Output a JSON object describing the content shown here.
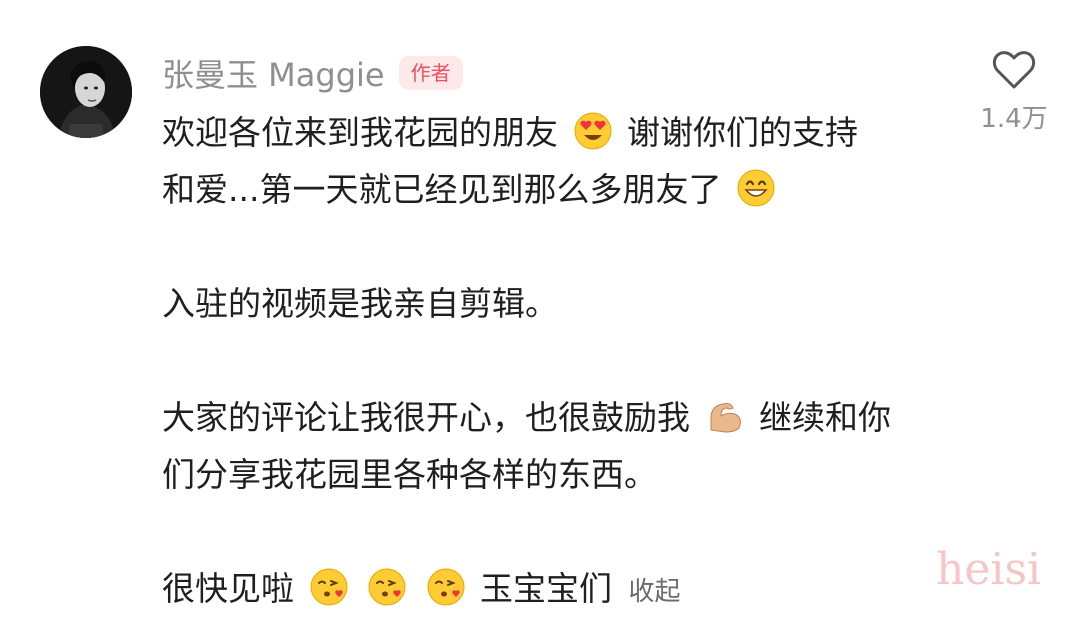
{
  "comment": {
    "author_name": "张曼玉 Maggie",
    "author_badge": "作者",
    "avatar_icon": "avatar-photo",
    "like_icon": "heart-outline-icon",
    "like_count": "1.4万",
    "paragraph1": {
      "seg1": "欢迎各位来到我花园的朋友",
      "emoji1": "heart-eyes-emoji",
      "seg2": "谢谢你们的支持",
      "seg3": "和爱...第一天就已经见到那么多朋友了",
      "emoji2": "grinning-face-emoji"
    },
    "paragraph2": "入驻的视频是我亲自剪辑。",
    "paragraph3": {
      "seg1": "大家的评论让我很开心，也很鼓励我",
      "emoji1": "flexed-biceps-emoji",
      "seg2": "继续和你",
      "seg3": "们分享我花园里各种各样的东西。"
    },
    "paragraph4": {
      "seg1": "很快见啦",
      "emoji1": "kissing-heart-emoji",
      "emoji2": "kissing-heart-emoji",
      "emoji3": "kissing-heart-emoji",
      "seg2": "玉宝宝们"
    },
    "collapse_label": "收起"
  },
  "watermark": "heisi",
  "colors": {
    "username": "#8f8f8f",
    "badge_text": "#ee4f5f",
    "badge_bg": "#fde8ea",
    "body_text": "#1f1f1f",
    "watermark": "#f3b3b3"
  }
}
